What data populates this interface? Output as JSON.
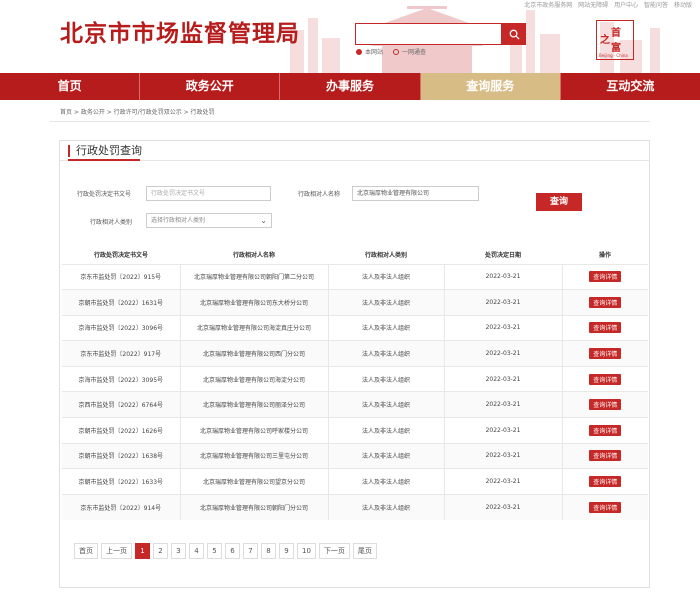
{
  "header": {
    "site_title": "北京市市场监督管理局",
    "top_links": [
      "北京市政务服务网",
      "网站无障碍",
      "用户中心",
      "智能问答",
      "移动版"
    ],
    "search_placeholder": "",
    "radio_options": [
      {
        "label": "本网站",
        "selected": true
      },
      {
        "label": "一网通查",
        "selected": false
      }
    ],
    "seal": {
      "chars": [
        "之",
        "首",
        "富"
      ],
      "latin": "Beijing · China"
    },
    "brand_color": "#b71c1c"
  },
  "nav": {
    "items": [
      {
        "label": "首页",
        "active": false
      },
      {
        "label": "政务公开",
        "active": false
      },
      {
        "label": "办事服务",
        "active": false
      },
      {
        "label": "查询服务",
        "active": true
      },
      {
        "label": "互动交流",
        "active": false
      }
    ],
    "active_color": "#d7bc85"
  },
  "breadcrumb": "首页 > 政务公开 > 行政许可/行政处罚双公示 > 行政处罚",
  "panel": {
    "title": "行政处罚查询",
    "form": {
      "doc_no_label": "行政处罚决定书文号",
      "doc_no_placeholder": "行政处罚决定书文号",
      "party_name_label": "行政相对人名称",
      "party_name_value": "北京瑞厚物业管理有限公司",
      "party_type_label": "行政相对人类别",
      "party_type_placeholder": "选择行政相对人类别",
      "query_label": "查询"
    },
    "table": {
      "headers": [
        "行政处罚决定书文号",
        "行政相对人名称",
        "行政相对人类别",
        "处罚决定日期",
        "操作"
      ],
      "rows": [
        [
          "京东市监处罚〔2022〕915号",
          "北京瑞厚物业管理有限公司朝阳门第二分公司",
          "法人及非法人组织",
          "2022-03-21",
          "查询详情"
        ],
        [
          "京朝市监处罚〔2022〕1631号",
          "北京瑞厚物业管理有限公司东大桥分公司",
          "法人及非法人组织",
          "2022-03-21",
          "查询详情"
        ],
        [
          "京海市监处罚〔2022〕3096号",
          "北京瑞厚物业管理有限公司海淀真庄分公司",
          "法人及非法人组织",
          "2022-03-21",
          "查询详情"
        ],
        [
          "京东市监处罚〔2022〕917号",
          "北京瑞厚物业管理有限公司西门分公司",
          "法人及非法人组织",
          "2022-03-21",
          "查询详情"
        ],
        [
          "京海市监处罚〔2022〕3095号",
          "北京瑞厚物业管理有限公司海淀分公司",
          "法人及非法人组织",
          "2022-03-21",
          "查询详情"
        ],
        [
          "京西市监处罚〔2022〕6764号",
          "北京瑞厚物业管理有限公司丽泽分公司",
          "法人及非法人组织",
          "2022-03-21",
          "查询详情"
        ],
        [
          "京朝市监处罚〔2022〕1626号",
          "北京瑞厚物业管理有限公司呼家楼分公司",
          "法人及非法人组织",
          "2022-03-21",
          "查询详情"
        ],
        [
          "京朝市监处罚〔2022〕1638号",
          "北京瑞厚物业管理有限公司三里屯分公司",
          "法人及非法人组织",
          "2022-03-21",
          "查询详情"
        ],
        [
          "京朝市监处罚〔2022〕1633号",
          "北京瑞厚物业管理有限公司望京分公司",
          "法人及非法人组织",
          "2022-03-21",
          "查询详情"
        ],
        [
          "京东市监处罚〔2022〕914号",
          "北京瑞厚物业管理有限公司朝阳门分公司",
          "法人及非法人组织",
          "2022-03-21",
          "查询详情"
        ]
      ]
    },
    "pagination": {
      "first": "首页",
      "prev": "上一页",
      "pages": [
        "1",
        "2",
        "3",
        "4",
        "5",
        "6",
        "7",
        "8",
        "9",
        "10"
      ],
      "current": "1",
      "next": "下一页",
      "last": "尾页"
    }
  }
}
